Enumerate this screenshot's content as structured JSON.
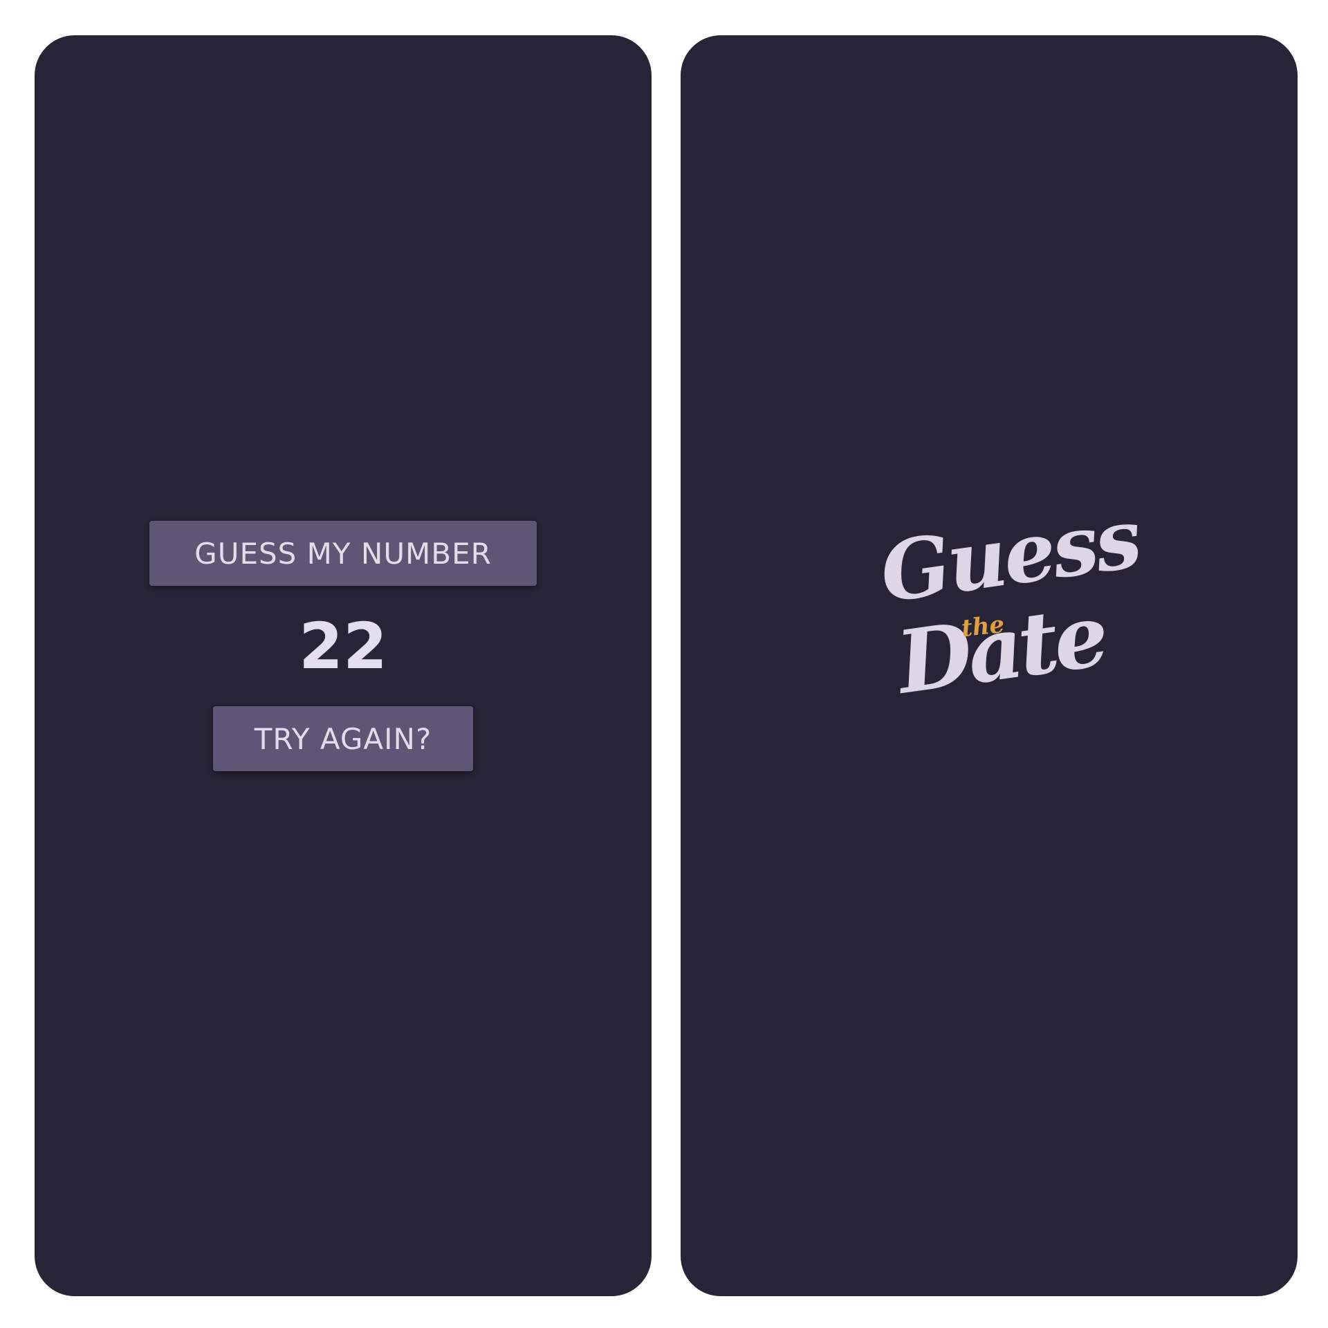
{
  "game_screen": {
    "title": "GUESS MY NUMBER",
    "number": "22",
    "retry_label": "TRY AGAIN?"
  },
  "splash_screen": {
    "logo": {
      "word_top": "Guess",
      "word_middle": "the",
      "word_bottom": "Date"
    }
  },
  "colors": {
    "background": "#282437",
    "button": "#5d5674",
    "text": "#e2dcee",
    "logo_accent": "#e0a040"
  }
}
